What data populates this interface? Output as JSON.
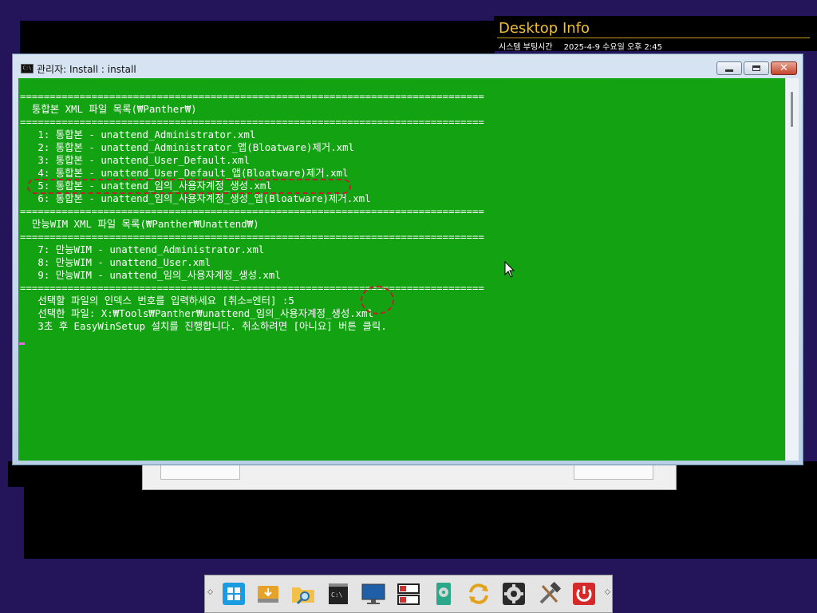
{
  "desktop_info": {
    "title": "Desktop Info",
    "label": "시스템 부팅시간",
    "value": "2025-4-9 수요일 오후 2:45"
  },
  "window": {
    "title": "관리자:  Install : install",
    "icon": "cmd-icon"
  },
  "console_lines": [
    "==============================================================================",
    "  통합본 XML 파일 목록(₩Panther₩)",
    "==============================================================================",
    "   1: 통합본 - unattend_Administrator.xml",
    "   2: 통합본 - unattend_Administrator_앱(Bloatware)제거.xml",
    "   3: 통합본 - unattend_User_Default.xml",
    "   4: 통합본 - unattend_User_Default_앱(Bloatware)제거.xml",
    "   5: 통합본 - unattend_임의_사용자계정_생성.xml",
    "   6: 통합본 - unattend_임의_사용자계정_생성_앱(Bloatware)제거.xml",
    "==============================================================================",
    "  만능WIM XML 파일 목록(₩Panther₩Unattend₩)",
    "==============================================================================",
    "   7: 만능WIM - unattend_Administrator.xml",
    "   8: 만능WIM - unattend_User.xml",
    "   9: 만능WIM - unattend_임의_사용자계정_생성.xml",
    "==============================================================================",
    "   선택할 파일의 인덱스 번호를 입력하세요 [취소=엔터] :5",
    "   선택한 파일: X:₩Tools₩Panther₩unattend_임의_사용자계정_생성.xml",
    "   3초 후 EasyWinSetup 설치를 진행합니다. 취소하려면 [아니요] 버튼 클릭."
  ],
  "taskbar": {
    "items": [
      {
        "name": "windows-start-icon"
      },
      {
        "name": "usb-drive-icon"
      },
      {
        "name": "folder-search-icon"
      },
      {
        "name": "command-prompt-icon"
      },
      {
        "name": "monitor-icon"
      },
      {
        "name": "disk-manager-icon"
      },
      {
        "name": "disk-utility-icon"
      },
      {
        "name": "sync-icon"
      },
      {
        "name": "settings-icon"
      },
      {
        "name": "tools-icon"
      },
      {
        "name": "power-icon"
      }
    ]
  },
  "colors": {
    "console_bg": "#12a212",
    "desktop_bg": "#24145a",
    "highlight": "#c0202a",
    "desktop_info_title": "#f0c030"
  }
}
